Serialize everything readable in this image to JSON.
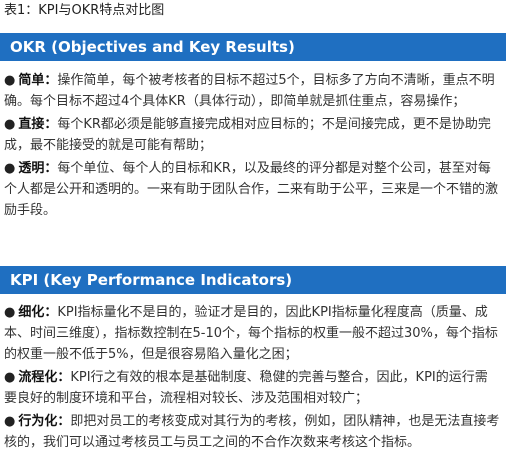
{
  "title": "表1：KPI与OKR特点对比图",
  "okr": {
    "heading": "OKR (Objectives and Key Results)",
    "items": [
      {
        "bullet": "●",
        "keyword": "简单：",
        "text": "操作简单，每个被考核者的目标不超过5个，目标多了方向不清晰，重点不明确。每个目标不超过4个具体KR（具体行动），即简单就是抓住重点，容易操作；"
      },
      {
        "bullet": "●",
        "keyword": "直接：",
        "text": "每个KR都必须是能够直接完成相对应目标的；不是间接完成，更不是协助完成，最不能接受的就是可能有帮助；"
      },
      {
        "bullet": "●",
        "keyword": "透明：",
        "text": "每个单位、每个人的目标和KR，以及最终的评分都是对整个公司，甚至对每个人都是公开和透明的。一来有助于团队合作，二来有助于公平，三来是一个不错的激励手段。"
      }
    ]
  },
  "kpi": {
    "heading": "KPI (Key Performance Indicators)",
    "items": [
      {
        "bullet": "●",
        "keyword": "细化：",
        "text": "KPI指标量化不是目的，验证才是目的，因此KPI指标量化程度高（质量、成本、时间三维度），指标数控制在5-10个，每个指标的权重一般不超过30%，每个指标的权重一般不低于5%，但是很容易陷入量化之困；"
      },
      {
        "bullet": "●",
        "keyword": "流程化：",
        "text": "KPI行之有效的根本是基础制度、稳健的完善与整合，因此，KPI的运行需要良好的制度环境和平台，流程相对较长、涉及范围相对较广；"
      },
      {
        "bullet": "●",
        "keyword": "行为化：",
        "text": "即把对员工的考核变成对其行为的考核，例如，团队精神，也是无法直接考核的，我们可以通过考核员工与员工之间的不合作次数来考核这个指标。"
      }
    ]
  }
}
